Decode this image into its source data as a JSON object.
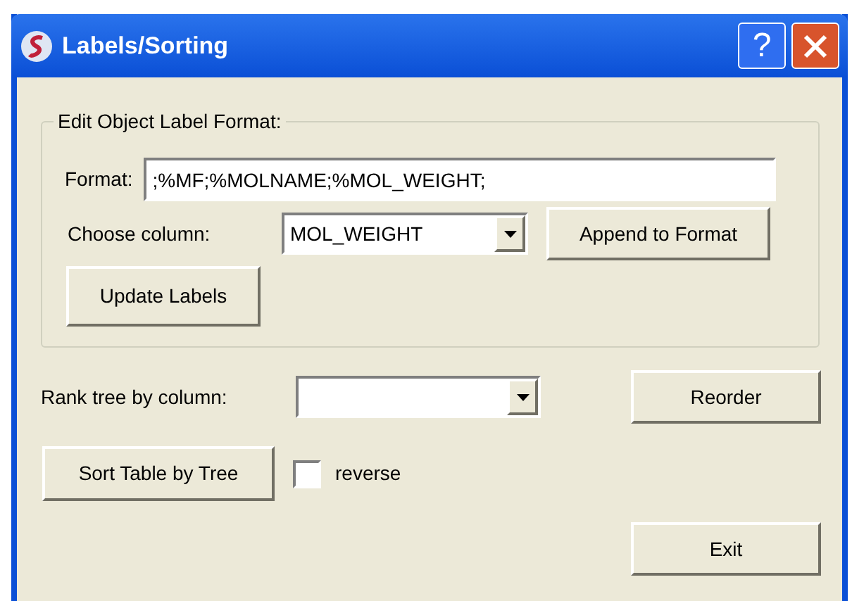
{
  "window": {
    "title": "Labels/Sorting",
    "help_button": "?"
  },
  "group": {
    "title": "Edit Object Label Format:",
    "format_label": "Format:",
    "format_value": ";%MF;%MOLNAME;%MOL_WEIGHT;",
    "column_label": "Choose column:",
    "column_value": "MOL_WEIGHT",
    "append_button": "Append to Format",
    "update_button": "Update Labels"
  },
  "rank": {
    "label": "Rank tree by column:",
    "reorder_button": "Reorder"
  },
  "sort_button": "Sort Table by Tree",
  "reverse": {
    "label": "reverse",
    "checked": false
  },
  "exit_button": "Exit"
}
